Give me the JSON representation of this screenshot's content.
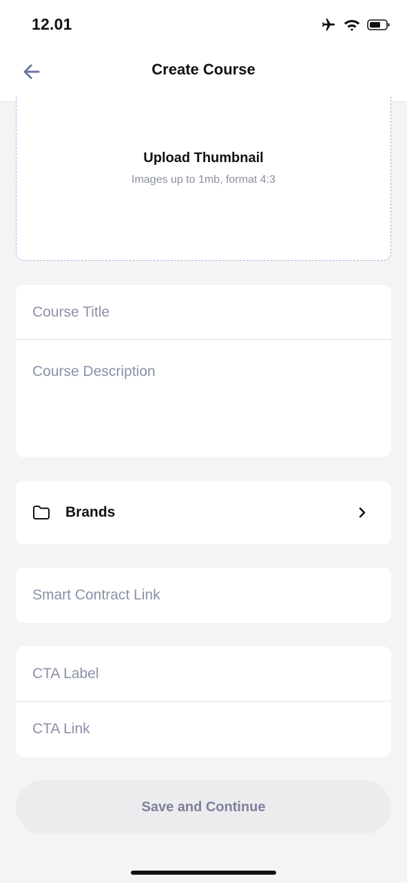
{
  "status_bar": {
    "time": "12.01",
    "icons": [
      "airplane-icon",
      "wifi-icon",
      "battery-icon"
    ]
  },
  "nav": {
    "back_icon": "arrow-left-icon",
    "title": "Create Course"
  },
  "upload": {
    "title": "Upload Thumbnail",
    "hint": "Images up to 1mb, format 4:3"
  },
  "course_info": {
    "title_placeholder": "Course Title",
    "title_value": "",
    "description_placeholder": "Course Description",
    "description_value": ""
  },
  "brands": {
    "icon": "folder-icon",
    "label": "Brands",
    "chevron_icon": "chevron-right-icon"
  },
  "smart_contract": {
    "placeholder": "Smart Contract Link",
    "value": ""
  },
  "cta": {
    "label_placeholder": "CTA Label",
    "label_value": "",
    "link_placeholder": "CTA Link",
    "link_value": ""
  },
  "save_button": {
    "label": "Save and Continue"
  },
  "colors": {
    "background": "#f4f4f5",
    "card": "#ffffff",
    "placeholder": "#8a90a8",
    "accent_back_arrow": "#6b72a3",
    "dashed_border": "#a9aedb",
    "button_disabled_bg": "#ececef",
    "button_disabled_text": "#7c819a"
  }
}
